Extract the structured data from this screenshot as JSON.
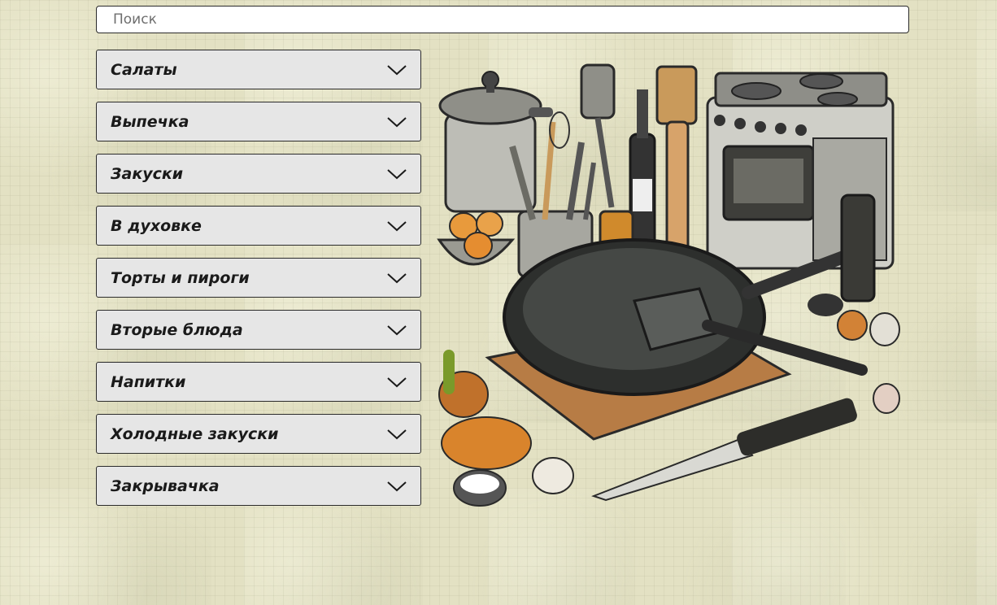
{
  "search": {
    "placeholder": "Поиск",
    "value": ""
  },
  "categories": [
    {
      "label": "Салаты",
      "icon": "chevron-down-icon"
    },
    {
      "label": "Выпечка",
      "icon": "chevron-down-icon"
    },
    {
      "label": "Закуски",
      "icon": "chevron-down-icon"
    },
    {
      "label": "В духовке",
      "icon": "chevron-down-icon"
    },
    {
      "label": "Торты и пироги",
      "icon": "chevron-down-icon"
    },
    {
      "label": "Вторые блюда",
      "icon": "chevron-down-icon"
    },
    {
      "label": "Напитки",
      "icon": "chevron-down-icon"
    },
    {
      "label": "Холодные закуски",
      "icon": "chevron-down-icon"
    },
    {
      "label": "Закрывачка",
      "icon": "chevron-down-icon"
    }
  ],
  "illustration": {
    "subject": "kitchen-utensils-illustration"
  },
  "colors": {
    "background": "#e3e1c3",
    "item_background": "#e6e6e6",
    "border": "#2b2b2b",
    "text": "#1a1a1a"
  }
}
